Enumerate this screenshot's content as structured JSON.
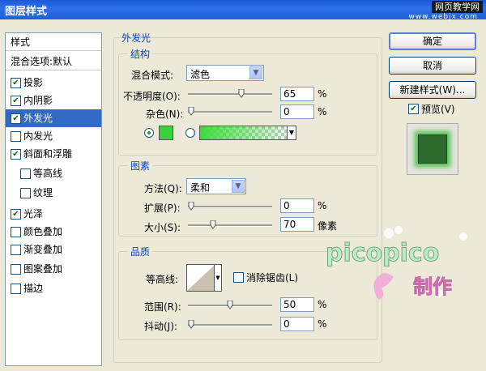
{
  "window": {
    "title": "图层样式",
    "watermark_top": "网页教学网",
    "watermark_url": "www.webjx.com"
  },
  "sidebar": {
    "header": "样式",
    "blend_options": "混合选项:默认",
    "items": [
      {
        "label": "投影",
        "checked": true
      },
      {
        "label": "内阴影",
        "checked": true
      },
      {
        "label": "外发光",
        "checked": true
      },
      {
        "label": "内发光",
        "checked": false
      },
      {
        "label": "斜面和浮雕",
        "checked": true
      },
      {
        "label": "等高线",
        "checked": false
      },
      {
        "label": "纹理",
        "checked": false
      },
      {
        "label": "光泽",
        "checked": true
      },
      {
        "label": "颜色叠加",
        "checked": false
      },
      {
        "label": "渐变叠加",
        "checked": false
      },
      {
        "label": "图案叠加",
        "checked": false
      },
      {
        "label": "描边",
        "checked": false
      }
    ]
  },
  "panel": {
    "title": "外发光",
    "structure": {
      "title": "结构",
      "blend_mode_label": "混合模式:",
      "blend_mode_value": "滤色",
      "opacity_label": "不透明度(O):",
      "opacity_value": "65",
      "noise_label": "杂色(N):",
      "noise_value": "0",
      "percent": "%",
      "solid_color": "#3ad23a"
    },
    "elements": {
      "title": "图素",
      "method_label": "方法(Q):",
      "method_value": "柔和",
      "spread_label": "扩展(P):",
      "spread_value": "0",
      "size_label": "大小(S):",
      "size_value": "70",
      "size_unit": "像素",
      "percent": "%"
    },
    "quality": {
      "title": "品质",
      "contour_label": "等高线:",
      "antialias_label": "消除锯齿(L)",
      "range_label": "范围(R):",
      "range_value": "50",
      "jitter_label": "抖动(J):",
      "jitter_value": "0",
      "percent": "%"
    }
  },
  "buttons": {
    "ok": "确定",
    "cancel": "取消",
    "new_style": "新建样式(W)...",
    "preview": "预览(V)"
  },
  "logo": {
    "text": "picopico",
    "sub": "制作"
  },
  "sliders": {
    "opacity": 0.65,
    "noise": 0,
    "spread": 0,
    "size": 0.28,
    "range": 0.5,
    "jitter": 0
  }
}
